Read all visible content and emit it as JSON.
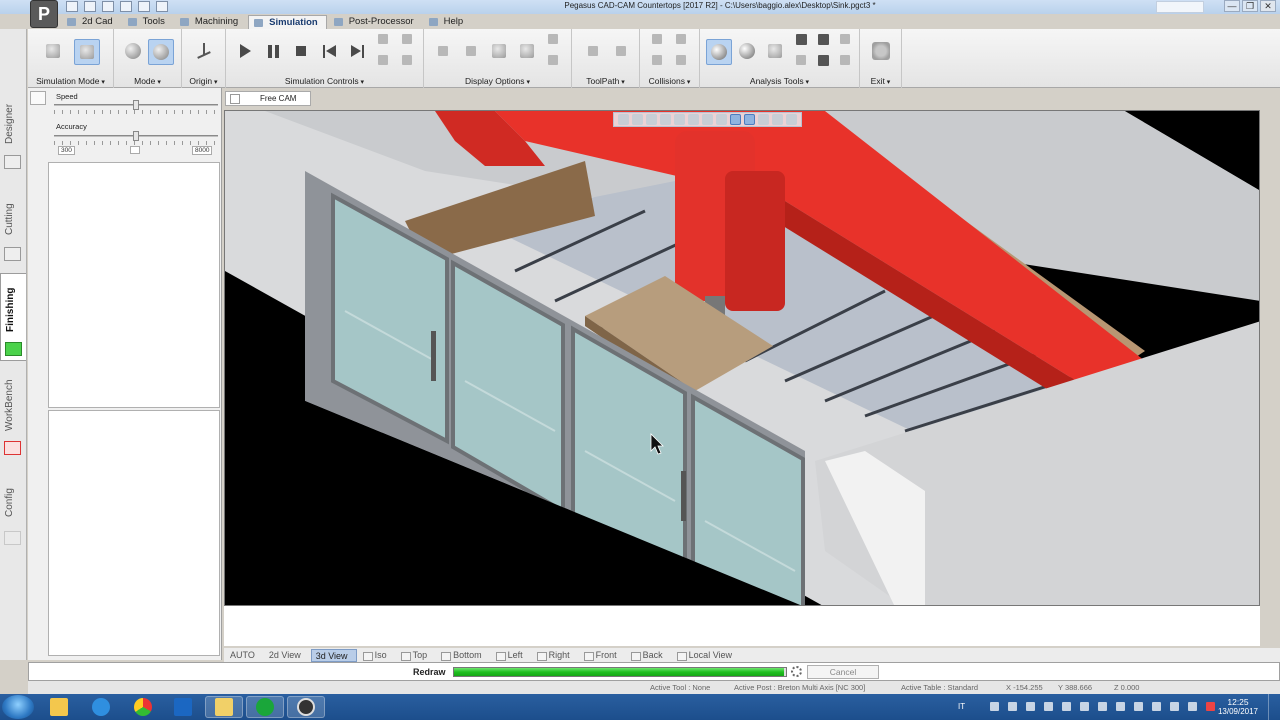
{
  "window": {
    "title": "Pegasus CAD-CAM Countertops [2017 R2] - C:\\Users\\baggio.alex\\Desktop\\Sink.pgct3 *",
    "logo_letter": "P",
    "controls": [
      "—",
      "❐",
      "✕"
    ]
  },
  "menu_tabs": [
    {
      "label": "2d Cad"
    },
    {
      "label": "Tools"
    },
    {
      "label": "Machining"
    },
    {
      "label": "Simulation",
      "active": true
    },
    {
      "label": "Post-Processor"
    },
    {
      "label": "Help"
    }
  ],
  "ribbon_groups": [
    {
      "label": "Simulation Mode"
    },
    {
      "label": "Mode"
    },
    {
      "label": "Origin"
    },
    {
      "label": "Simulation Controls"
    },
    {
      "label": "Display Options"
    },
    {
      "label": "ToolPath"
    },
    {
      "label": "Collisions"
    },
    {
      "label": "Analysis Tools"
    },
    {
      "label": "Exit"
    }
  ],
  "side_tabs": [
    {
      "label": "Designer"
    },
    {
      "label": "Cutting"
    },
    {
      "label": "Finishing",
      "active": true
    },
    {
      "label": "WorkBench"
    },
    {
      "label": "Config"
    }
  ],
  "panel": {
    "speed": {
      "label": "Speed",
      "level": 0.5
    },
    "accuracy": {
      "label": "Accuracy",
      "min": "300",
      "max": "8000",
      "level": 0.5
    }
  },
  "view_tab": {
    "label": "Free CAM"
  },
  "view_strip": [
    {
      "label": "AUTO",
      "first": true
    },
    {
      "label": "2d View",
      "noico": true
    },
    {
      "label": "3d View",
      "active": true,
      "noico": true
    },
    {
      "label": "Iso"
    },
    {
      "label": "Top"
    },
    {
      "label": "Bottom"
    },
    {
      "label": "Left"
    },
    {
      "label": "Right"
    },
    {
      "label": "Front"
    },
    {
      "label": "Back"
    },
    {
      "label": "Local View"
    }
  ],
  "progress": {
    "label": "Redraw",
    "fraction": 0.994,
    "cancel_label": "Cancel"
  },
  "status": {
    "active_tool": "Active Tool : None",
    "active_post": "Active Post : Breton Multi Axis [NC 300]",
    "active_table": "Active Table : Standard",
    "x": "X -154.255",
    "y": "Y 388.666",
    "z": "Z 0.000"
  },
  "taskbar": {
    "apps": [
      "file-explorer",
      "internet-explorer",
      "chrome",
      "outlook",
      "folder",
      "pegasus",
      "obs"
    ],
    "lang": "IT",
    "time": "12:25",
    "date": "13/09/2017"
  },
  "colors": {
    "gantry_red": "#e8322a",
    "progress_green": "#1fbf1f",
    "active_blue": "#b9d3f1"
  }
}
